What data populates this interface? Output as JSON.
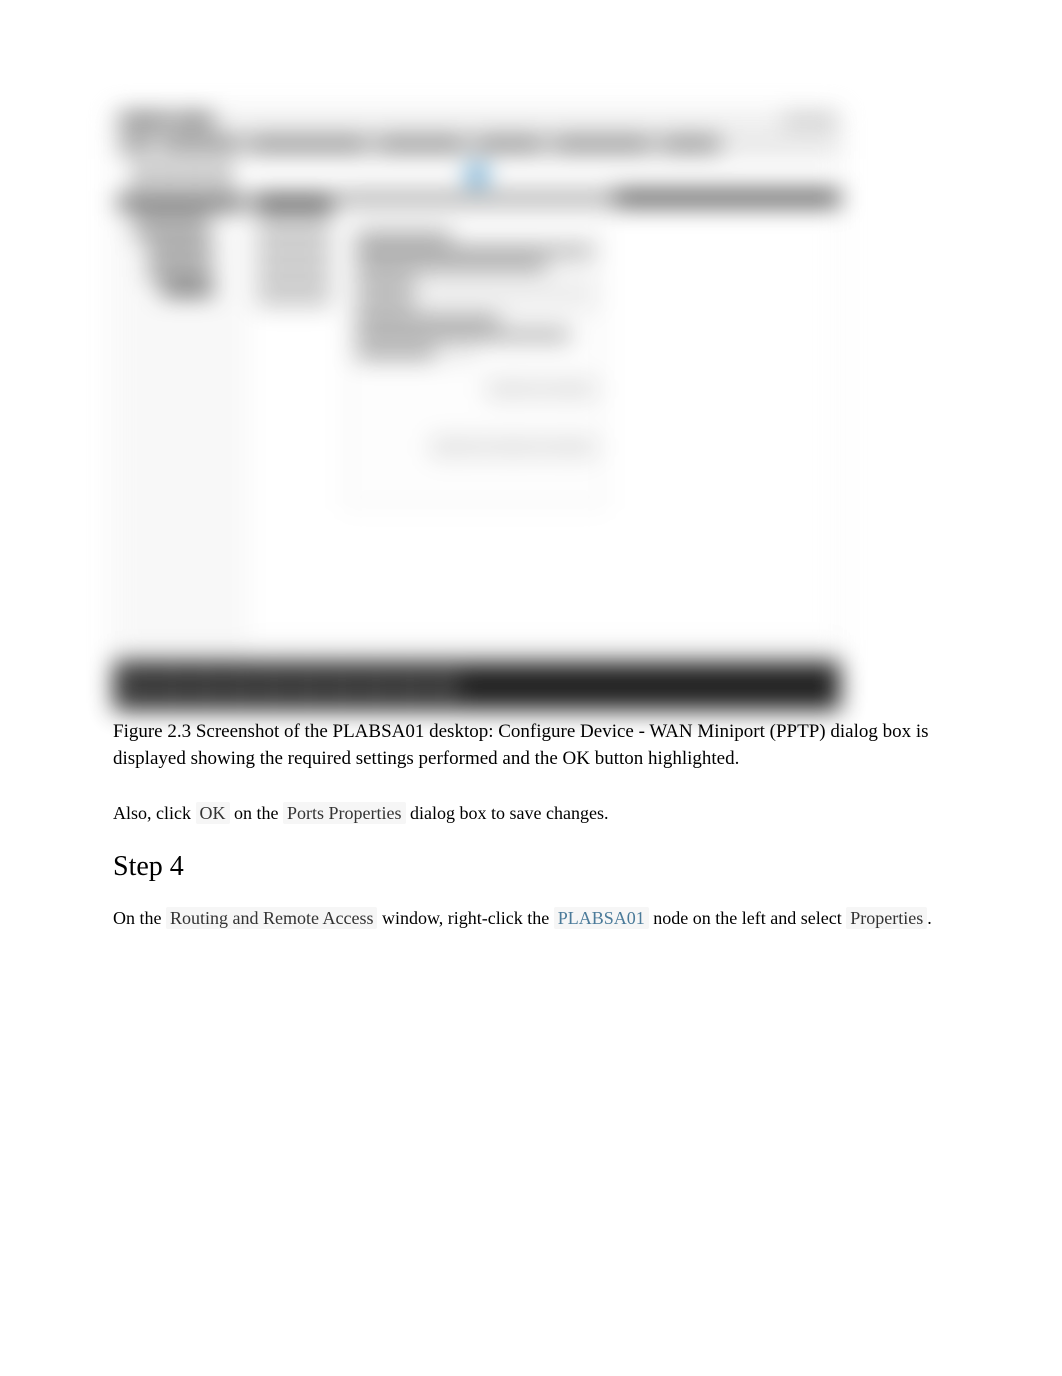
{
  "figure": {
    "caption": "Figure 2.3 Screenshot of the PLABSA01 desktop: Configure Device - WAN Miniport (PPTP) dialog box is displayed showing the required settings performed and the OK button highlighted."
  },
  "instruction1": {
    "prefix": "Also, click ",
    "ok_label": "OK",
    "mid": " on the ",
    "ports_label": "Ports Properties",
    "suffix": " dialog box to save changes."
  },
  "step4": {
    "heading": "Step 4",
    "line1_prefix": "On the ",
    "rra_label": "Routing and Remote Access",
    "line1_mid": " window, right-click the ",
    "server_label": "PLABSA01",
    "line1_suffix": " node on the left and select ",
    "properties_label": "Properties",
    "line1_end": "."
  }
}
